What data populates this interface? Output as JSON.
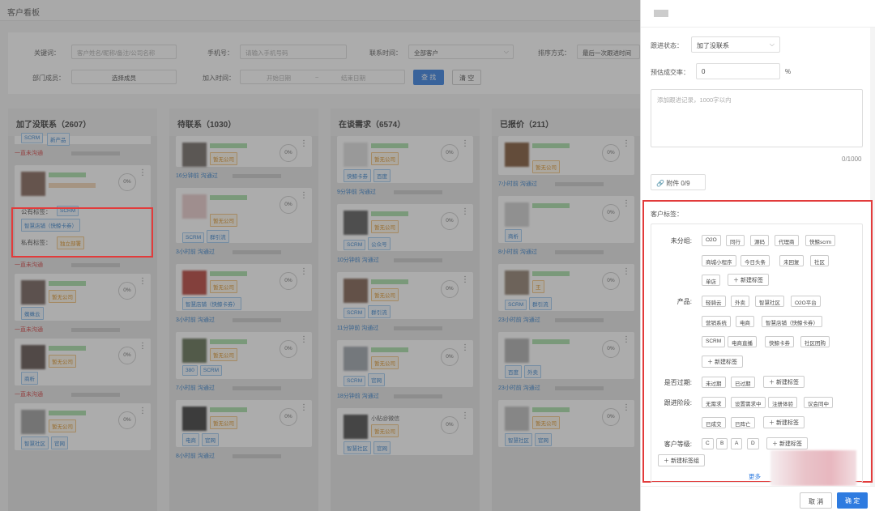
{
  "page": {
    "title": "客户看板"
  },
  "filters": {
    "keyword_label": "关键词：",
    "keyword_placeholder": "客户姓名/昵称/备注/公司名称",
    "phone_label": "手机号：",
    "phone_placeholder": "请输入手机号码",
    "contact_time_label": "联系时间：",
    "contact_time_value": "全部客户",
    "sort_label": "排序方式：",
    "sort_value": "最后一次跟进时间",
    "dept_label": "部门成员：",
    "dept_value": "选择成员",
    "join_label": "加入时间：",
    "start_placeholder": "开始日期",
    "range_sep": "~",
    "end_placeholder": "结束日期",
    "search_btn": "查 找",
    "clear_btn": "清 空"
  },
  "columns": [
    {
      "title": "加了没联系（2607）"
    },
    {
      "title": "待联系（1030）"
    },
    {
      "title": "在谈需求（6574）"
    },
    {
      "title": "已报价（211）"
    }
  ],
  "col1": {
    "top_tag": "SCRM",
    "top_tag2": "新产品",
    "status1": "一直未沟通",
    "pct": "0%",
    "public_label": "公有标签：",
    "public_tag1": "SCRM",
    "public_tag2": "智慧店铺（快鲸卡券）",
    "private_label": "私有标签：",
    "private_tag1": "独立部署",
    "status2": "一直未沟通",
    "c3_tag": "暂无公司",
    "c3_tag2": "蜘蛛云",
    "status3": "一直未沟通",
    "c4_tag": "暂无公司",
    "c4_tag2": "商析",
    "status4": "一直未沟通",
    "c5_tag": "暂无公司",
    "c5_tag2": "智慧社区",
    "c5_tag3": "官网"
  },
  "col2": {
    "c1_tag": "暂无公司",
    "c1_meta": "16分钟前 沟通过",
    "c2_tag": "暂无公司",
    "c2_t1": "SCRM",
    "c2_t2": "群引流",
    "c2_meta": "3小时前 沟通过",
    "c3_tag": "暂无公司",
    "c3_t1": "智慧店铺（快鲸卡券）",
    "c3_meta": "3小时前 沟通过",
    "c4_tag": "暂无公司",
    "c4_t1": "380",
    "c4_t2": "SCRM",
    "c4_meta": "7小时前 沟通过",
    "c5_tag": "暂无公司",
    "c5_t1": "电商",
    "c5_t2": "官网",
    "c5_meta": "8小时前 沟通过"
  },
  "col3": {
    "c1_tag": "暂无公司",
    "c1_t1": "快鲸卡券",
    "c1_t2": "百度",
    "c1_meta": "9分钟前 沟通过",
    "c2_tag": "暂无公司",
    "c2_t1": "SCRM",
    "c2_t2": "公众号",
    "c2_meta": "10分钟前 沟通过",
    "c3_tag": "暂无公司",
    "c3_t1": "SCRM",
    "c3_t2": "群引流",
    "c3_meta": "11分钟前 沟通过",
    "c4_tag": "暂无公司",
    "c4_t1": "SCRM",
    "c4_t2": "官网",
    "c4_meta": "18分钟前 沟通过",
    "c5_name": "小贴@微信",
    "c5_tag": "暂无公司",
    "c5_t1": "智慧社区",
    "c5_t2": "官网"
  },
  "col4": {
    "c1_tag": "暂无公司",
    "c1_meta": "7小时前 沟通过",
    "c2_t1": "商析",
    "c2_meta": "8小时前 沟通过",
    "c3_tag": "王",
    "c3_t1": "SCRM",
    "c3_t2": "群引流",
    "c3_meta": "23小时前 沟通过",
    "c4_t1": "百度",
    "c4_t2": "外卖",
    "c4_meta": "23小时前 沟通过",
    "c5_tag": "暂无公司",
    "c5_t1": "智慧社区",
    "c5_t2": "官网"
  },
  "drawer": {
    "status_label": "跟进状态：",
    "status_value": "加了没联系",
    "rate_label": "预估成交率：",
    "rate_value": "0",
    "rate_unit": "%",
    "note_placeholder": "添加跟进记录，1000字以内",
    "note_count": "0/1000",
    "attach_btn": "附件 0/9",
    "tags_title": "客户标签：",
    "groups": [
      {
        "label": "未分组:",
        "tags": [
          "O2O",
          "同行",
          "源码",
          "代理商",
          "快鲸scrm",
          "商城小程序",
          "今日头条",
          "未回复",
          "社区",
          "单店"
        ]
      },
      {
        "label": "产品:",
        "tags": [
          "轻骑云",
          "外卖",
          "智慧社区",
          "O2O平台",
          "营销系统",
          "电商",
          "智慧店铺（快鲸卡券）",
          "SCRM",
          "电商直播",
          "快鲸卡券",
          "社区团购"
        ]
      },
      {
        "label": "是否过期:",
        "tags": [
          "未过期",
          "已过期"
        ]
      },
      {
        "label": "跟进阶段:",
        "tags": [
          "无需求",
          "设置需求中",
          "注册体验",
          "议会同中",
          "已成交",
          "已阵亡"
        ]
      },
      {
        "label": "客户等级:",
        "tags": [
          "C",
          "B",
          "A",
          "D"
        ]
      }
    ],
    "new_tag": "＋ 新建标签",
    "new_group": "＋ 新建标签组",
    "more": "更多",
    "cancel": "取 消",
    "confirm": "确 定"
  }
}
